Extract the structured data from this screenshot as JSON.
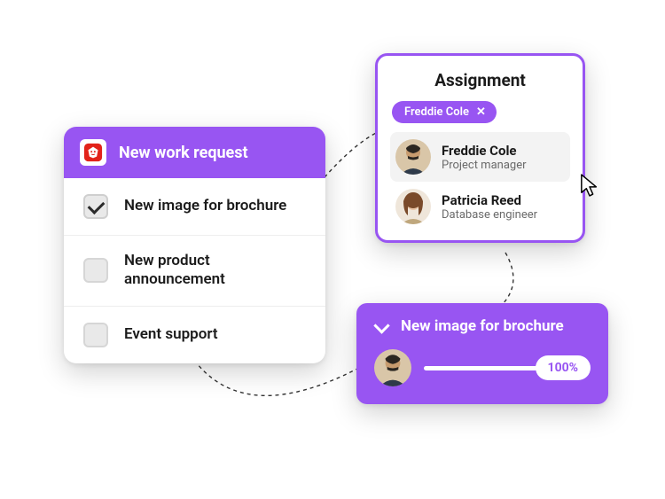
{
  "colors": {
    "accent": "#9855f2"
  },
  "work_request": {
    "title": "New work request",
    "items": [
      {
        "label": "New image for brochure",
        "checked": true
      },
      {
        "label": "New product announcement",
        "checked": false
      },
      {
        "label": "Event support",
        "checked": false
      }
    ]
  },
  "assignment": {
    "title": "Assignment",
    "chip": {
      "label": "Freddie Cole"
    },
    "people": [
      {
        "name": "Freddie Cole",
        "role": "Project manager",
        "selected": true
      },
      {
        "name": "Patricia Reed",
        "role": "Database engineer",
        "selected": false
      }
    ]
  },
  "progress": {
    "title": "New image for brochure",
    "percent_label": "100%"
  }
}
